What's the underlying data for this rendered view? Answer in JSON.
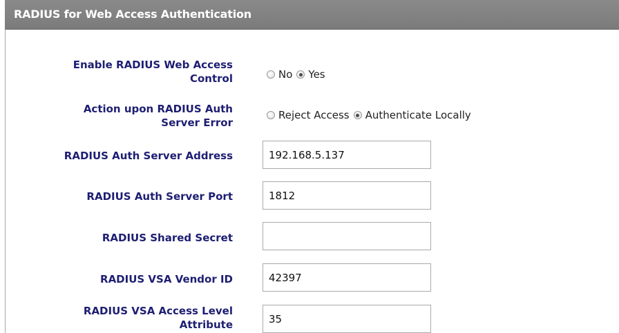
{
  "header": {
    "title": "RADIUS for Web Access Authentication"
  },
  "fields": {
    "enable_control": {
      "label_line1": "Enable RADIUS Web Access",
      "label_line2": "Control",
      "options": [
        {
          "label": "No",
          "checked": false
        },
        {
          "label": "Yes",
          "checked": true
        }
      ]
    },
    "action_on_error": {
      "label_line1": "Action upon RADIUS Auth",
      "label_line2": "Server Error",
      "options": [
        {
          "label": "Reject Access",
          "checked": false
        },
        {
          "label": "Authenticate Locally",
          "checked": true
        }
      ]
    },
    "server_address": {
      "label": "RADIUS Auth Server Address",
      "value": "192.168.5.137"
    },
    "server_port": {
      "label": "RADIUS Auth Server Port",
      "value": "1812"
    },
    "shared_secret": {
      "label": "RADIUS Shared Secret",
      "value": ""
    },
    "vendor_id": {
      "label": "RADIUS VSA Vendor ID",
      "value": "42397"
    },
    "access_level_attribute": {
      "label_line1": "RADIUS VSA Access Level",
      "label_line2": "Attribute",
      "value": "35"
    }
  },
  "colors": {
    "header_bg": "#808080",
    "label_text": "#1e1e73",
    "header_text": "#ffffff"
  }
}
